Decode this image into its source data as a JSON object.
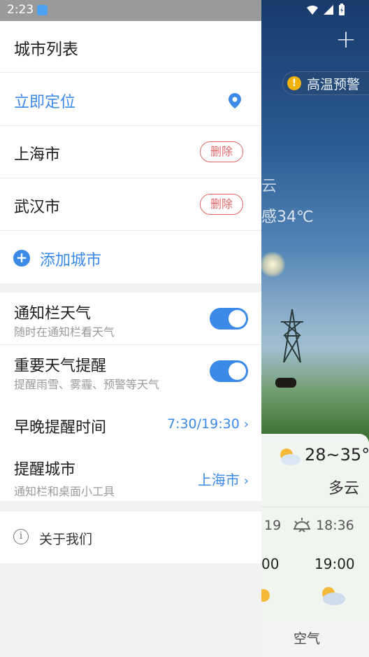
{
  "status": {
    "time": "2:23"
  },
  "drawer": {
    "title": "城市列表",
    "locate": "立即定位",
    "cities": [
      {
        "name": "上海市",
        "delete_label": "删除"
      },
      {
        "name": "武汉市",
        "delete_label": "删除"
      }
    ],
    "add_city": "添加城市",
    "settings": {
      "notify_bar": {
        "title": "通知栏天气",
        "subtitle": "随时在通知栏看天气",
        "enabled": true
      },
      "important_alert": {
        "title": "重要天气提醒",
        "subtitle": "提醒雨雪、雾霾、预警等天气",
        "enabled": true
      },
      "remind_time": {
        "title": "早晚提醒时间",
        "value": "7:30/19:30"
      },
      "remind_city": {
        "title": "提醒城市",
        "subtitle": "通知栏和桌面小工具",
        "value": "上海市"
      }
    },
    "about": "关于我们"
  },
  "background": {
    "alert": "高温预警",
    "feels_like": "感34℃",
    "fragment": "云",
    "today": {
      "temp_range": "28~35°",
      "condition": "多云"
    },
    "sun_frag": "19",
    "sunset": "18:36",
    "hours": [
      "00",
      "19:00"
    ],
    "air_label": "空气"
  },
  "colors": {
    "accent": "#3b8ae8",
    "delete": "#e06767",
    "warning": "#f2b10c"
  }
}
